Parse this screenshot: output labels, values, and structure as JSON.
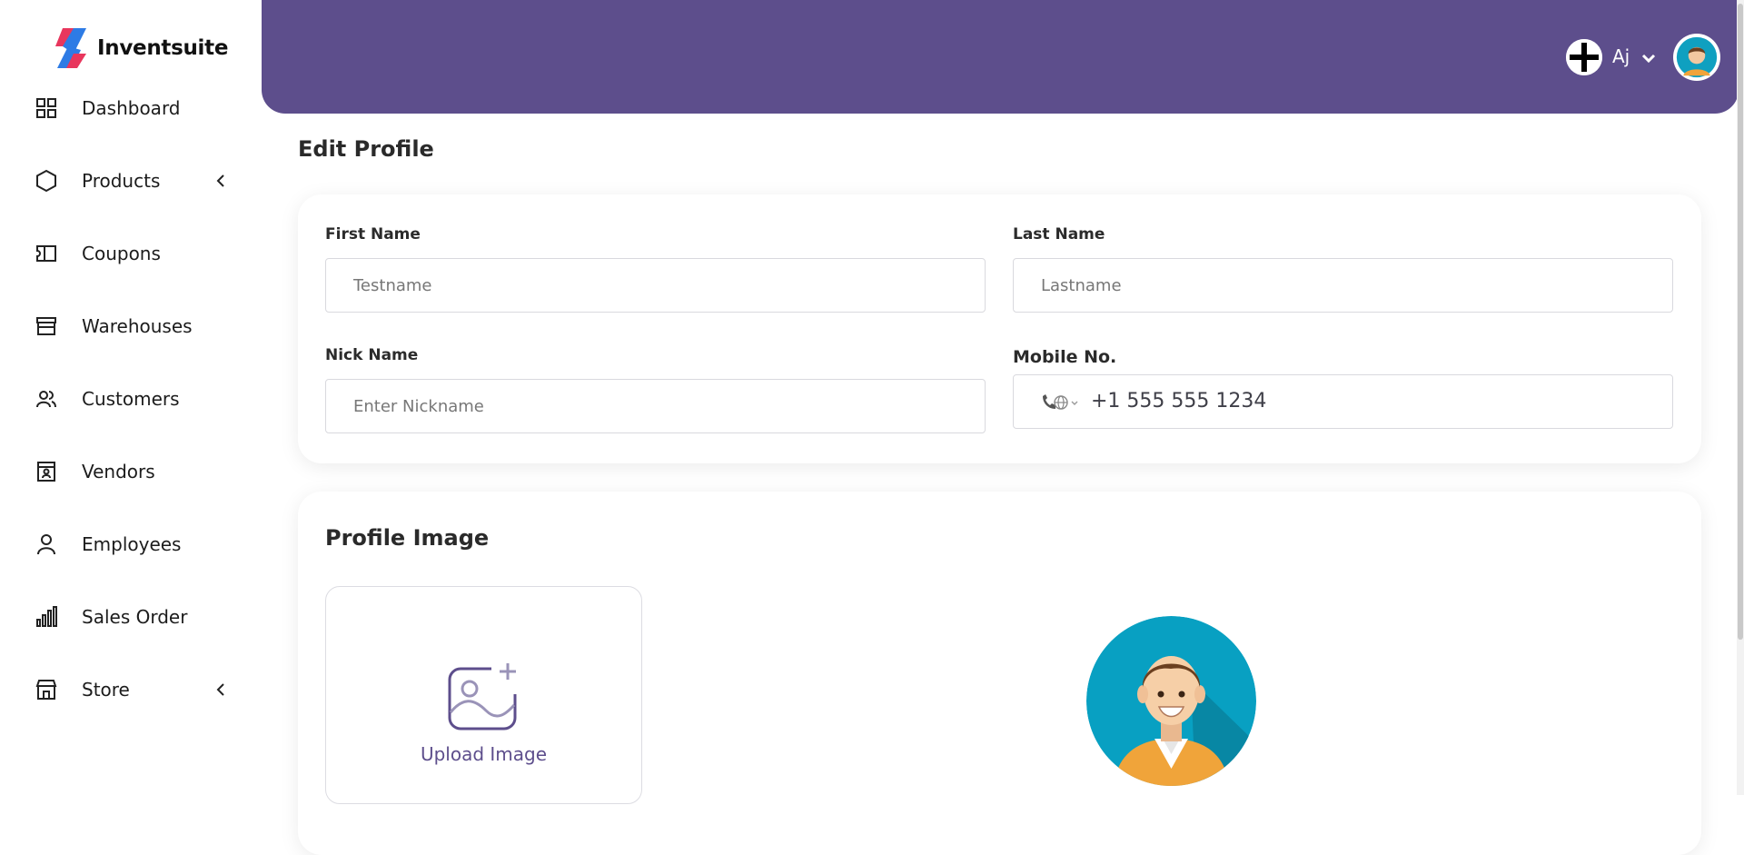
{
  "app": {
    "name": "Inventsuite"
  },
  "sidebar": {
    "items": [
      {
        "label": "Dashboard",
        "icon": "dashboard-icon",
        "has_chevron": false
      },
      {
        "label": "Products",
        "icon": "box-icon",
        "has_chevron": true
      },
      {
        "label": "Coupons",
        "icon": "ticket-icon",
        "has_chevron": false
      },
      {
        "label": "Warehouses",
        "icon": "warehouse-icon",
        "has_chevron": false
      },
      {
        "label": "Customers",
        "icon": "customers-icon",
        "has_chevron": false
      },
      {
        "label": "Vendors",
        "icon": "vendor-icon",
        "has_chevron": false
      },
      {
        "label": "Employees",
        "icon": "user-icon",
        "has_chevron": false
      },
      {
        "label": "Sales Order",
        "icon": "bar-chart-icon",
        "has_chevron": false
      },
      {
        "label": "Store",
        "icon": "store-icon",
        "has_chevron": true
      }
    ]
  },
  "header": {
    "user_name": "Aj",
    "accent": "#5d4e8c"
  },
  "main": {
    "title": "Edit Profile",
    "form": {
      "first_name": {
        "label": "First Name",
        "placeholder": "Testname",
        "value": ""
      },
      "last_name": {
        "label": "Last Name",
        "placeholder": "Lastname",
        "value": ""
      },
      "nick_name": {
        "label": "Nick Name",
        "placeholder": "Enter Nickname",
        "value": ""
      },
      "mobile": {
        "label": "Mobile No.",
        "value": "+1 555 555 1234"
      }
    },
    "profile_image": {
      "title": "Profile Image",
      "upload_label": "Upload Image"
    }
  }
}
